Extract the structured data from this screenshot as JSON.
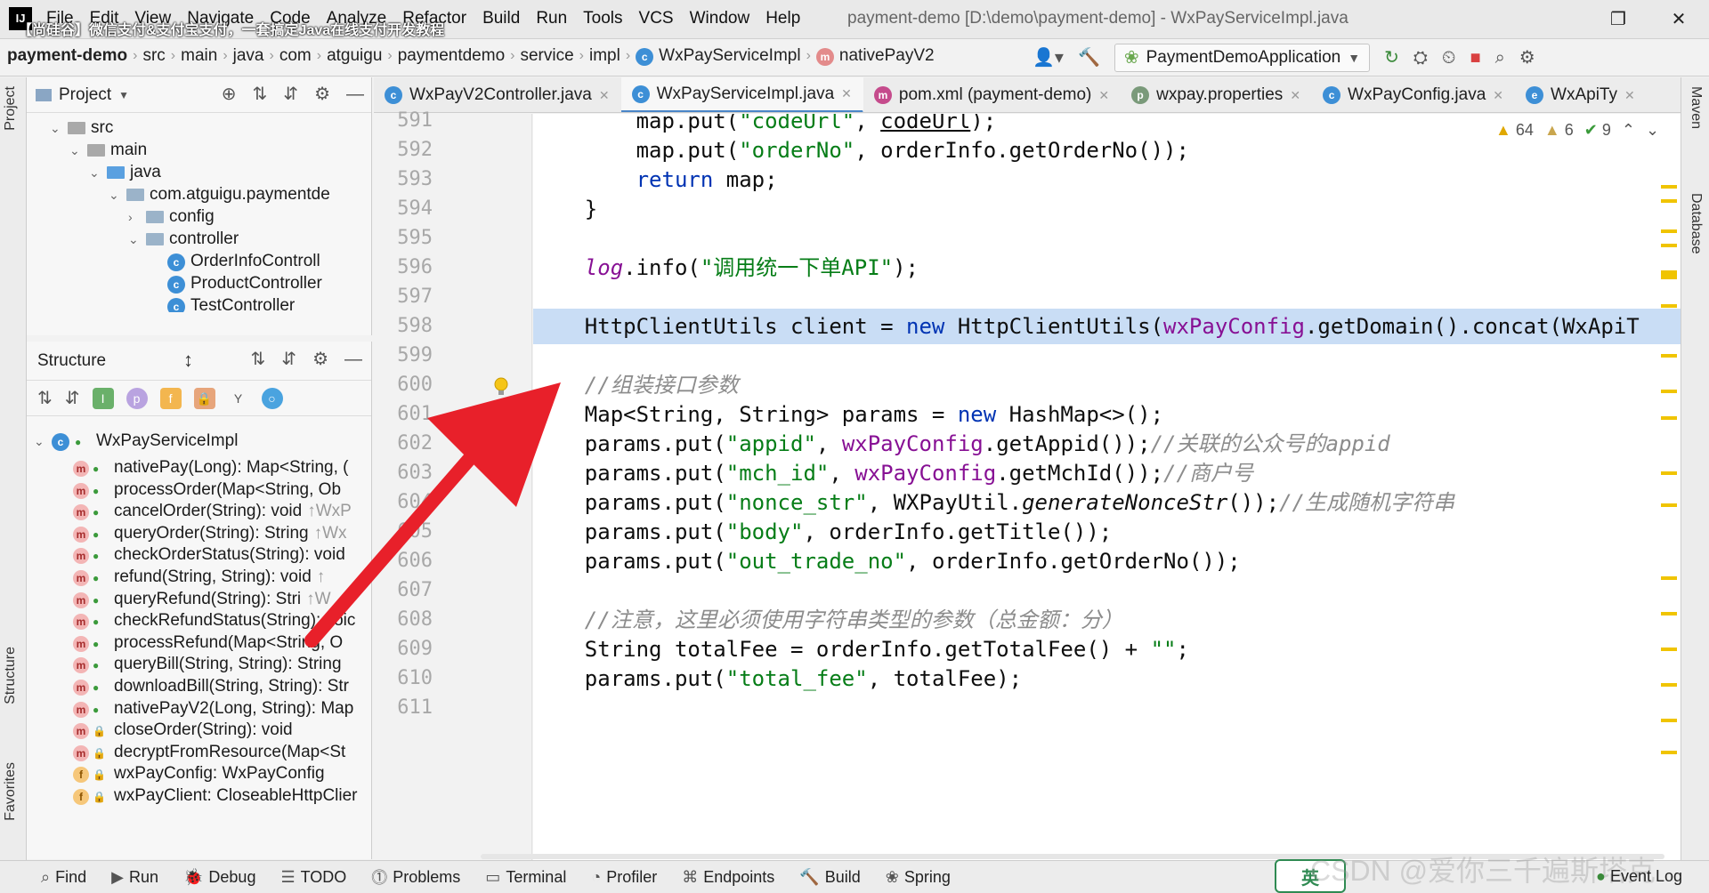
{
  "app_logo": "IJ",
  "video_title": "【尚硅谷】微信支付&支付宝支付，一套搞定Java在线支付开发教程",
  "menu": [
    "File",
    "Edit",
    "View",
    "Navigate",
    "Code",
    "Analyze",
    "Refactor",
    "Build",
    "Run",
    "Tools",
    "VCS",
    "Window",
    "Help"
  ],
  "window_title": "payment-demo [D:\\demo\\payment-demo] - WxPayServiceImpl.java",
  "window_controls": {
    "restore": "❐",
    "close": "✕"
  },
  "breadcrumb": {
    "project": "payment-demo",
    "items": [
      "src",
      "main",
      "java",
      "com",
      "atguigu",
      "paymentdemo",
      "service",
      "impl"
    ],
    "class": "WxPayServiceImpl",
    "method": "nativePayV2"
  },
  "run_config": "PaymentDemoApplication",
  "project_panel": {
    "title": "Project",
    "tree": [
      "src",
      "main",
      "java",
      "com.atguigu.paymentde",
      "config",
      "controller",
      "OrderInfoControll",
      "ProductController",
      "TestController"
    ]
  },
  "structure_panel": {
    "title": "Structure",
    "filters": [
      "I",
      "p",
      "f",
      "🔒",
      "Y",
      "○"
    ],
    "root": "WxPayServiceImpl",
    "items": [
      {
        "kind": "m",
        "vis": "public",
        "label": "nativePay(Long): Map<String, ("
      },
      {
        "kind": "m",
        "vis": "public",
        "label": "processOrder(Map<String, Ob"
      },
      {
        "kind": "m",
        "vis": "public",
        "label": "cancelOrder(String): void",
        "hint": "↑WxP"
      },
      {
        "kind": "m",
        "vis": "public",
        "label": "queryOrder(String): String",
        "hint": "↑Wx"
      },
      {
        "kind": "m",
        "vis": "public",
        "label": "checkOrderStatus(String): void"
      },
      {
        "kind": "m",
        "vis": "public",
        "label": "refund(String, String): void",
        "hint": "↑"
      },
      {
        "kind": "m",
        "vis": "public",
        "label": "queryRefund(String): Stri",
        "hint": "↑W"
      },
      {
        "kind": "m",
        "vis": "public",
        "label": "checkRefundStatus(String): voic"
      },
      {
        "kind": "m",
        "vis": "public",
        "label": "processRefund(Map<String, O"
      },
      {
        "kind": "m",
        "vis": "public",
        "label": "queryBill(String, String): String"
      },
      {
        "kind": "m",
        "vis": "public",
        "label": "downloadBill(String, String): Str"
      },
      {
        "kind": "m",
        "vis": "public",
        "label": "nativePayV2(Long, String): Map"
      },
      {
        "kind": "m",
        "vis": "private",
        "label": "closeOrder(String): void"
      },
      {
        "kind": "m",
        "vis": "private",
        "label": "decryptFromResource(Map<St"
      },
      {
        "kind": "f",
        "vis": "private",
        "label": "wxPayConfig: WxPayConfig"
      },
      {
        "kind": "f",
        "vis": "private",
        "label": "wxPayClient: CloseableHttpClier"
      }
    ]
  },
  "tabs": [
    {
      "label": "WxPayV2Controller.java",
      "icon": "c"
    },
    {
      "label": "WxPayServiceImpl.java",
      "icon": "c",
      "active": true
    },
    {
      "label": "pom.xml (payment-demo)",
      "icon": "m"
    },
    {
      "label": "wxpay.properties",
      "icon": "p"
    },
    {
      "label": "WxPayConfig.java",
      "icon": "c"
    },
    {
      "label": "WxApiTy",
      "icon": "e"
    }
  ],
  "inspections": {
    "warnings": "64",
    "weak": "6",
    "typos": "9"
  },
  "line_numbers": [
    "591",
    "592",
    "593",
    "594",
    "595",
    "596",
    "597",
    "598",
    "599",
    "600",
    "601",
    "602",
    "603",
    "604",
    "605",
    "606",
    "607",
    "608",
    "609",
    "610",
    "611"
  ],
  "code": {
    "l591": "map.put(\"codeUrl\", codeUrl);",
    "l592": "map.put(\"orderNo\", orderInfo.getOrderNo());",
    "l593": "return map;",
    "l594": "}",
    "l596": "log.info(\"调用统一下单API\");",
    "l598": "HttpClientUtils client = new HttpClientUtils(wxPayConfig.getDomain().concat(WxApiT",
    "l600": "//组装接口参数",
    "l601": "Map<String, String> params = new HashMap<>();",
    "l602": "params.put(\"appid\", wxPayConfig.getAppid());//关联的公众号的appid",
    "l603": "params.put(\"mch_id\", wxPayConfig.getMchId());//商户号",
    "l604": "params.put(\"nonce_str\", WXPayUtil.generateNonceStr());//生成随机字符串",
    "l605": "params.put(\"body\", orderInfo.getTitle());",
    "l606": "params.put(\"out_trade_no\", orderInfo.getOrderNo());",
    "l608": "//注意，这里必须使用字符串类型的参数（总金额：分）",
    "l609": "String totalFee = orderInfo.getTotalFee() + \"\";",
    "l610": "params.put(\"total_fee\", totalFee);"
  },
  "bottom_tools": [
    "Find",
    "Run",
    "Debug",
    "TODO",
    "Problems",
    "Terminal",
    "Profiler",
    "Endpoints",
    "Build",
    "Spring"
  ],
  "event_log": "Event Log",
  "ime": "英",
  "watermark": "CSDN @爱你三千遍斯塔克",
  "left_tabs": [
    "Project",
    "Structure",
    "Favorites"
  ],
  "right_tabs": [
    "Maven",
    "Database"
  ]
}
